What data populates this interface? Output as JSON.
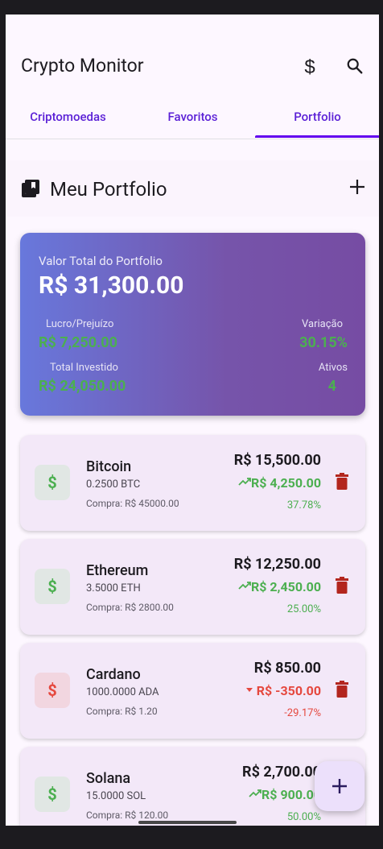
{
  "app": {
    "title": "Crypto Monitor"
  },
  "appbar": {
    "dollar_icon": "dollar-icon",
    "search_icon": "search-icon"
  },
  "tabs": [
    {
      "label": "Criptomoedas"
    },
    {
      "label": "Favoritos"
    },
    {
      "label": "Portfolio",
      "selected": true
    }
  ],
  "section": {
    "title": "Meu Portfolio",
    "icon": "wallet-icon",
    "action_icon": "add-icon"
  },
  "summary": {
    "label": "Valor Total do Portfolio",
    "total": "R$ 31,300.00",
    "profit_label": "Lucro/Prejuízo",
    "profit_value": "R$ 7,250.00",
    "variation_label": "Variação",
    "variation_value": "30.15%",
    "invested_label": "Total Investido",
    "invested_value": "R$ 24,050.00",
    "assets_label": "Ativos",
    "assets_value": "4"
  },
  "holdings": [
    {
      "name": "Bitcoin",
      "qty": "0.2500 BTC",
      "buy": "Compra: R$ 45000.00",
      "value": "R$ 15,500.00",
      "pl": "R$ 4,250.00",
      "pct": "37.78%",
      "trend": "up"
    },
    {
      "name": "Ethereum",
      "qty": "3.5000 ETH",
      "buy": "Compra: R$ 2800.00",
      "value": "R$ 12,250.00",
      "pl": "R$ 2,450.00",
      "pct": "25.00%",
      "trend": "up"
    },
    {
      "name": "Cardano",
      "qty": "1000.0000 ADA",
      "buy": "Compra: R$ 1.20",
      "value": "R$ 850.00",
      "pl": "R$ -350.00",
      "pct": "-29.17%",
      "trend": "down"
    },
    {
      "name": "Solana",
      "qty": "15.0000 SOL",
      "buy": "Compra: R$ 120.00",
      "value": "R$ 2,700.00",
      "pl": "R$ 900.00",
      "pct": "50.00%",
      "trend": "up"
    }
  ],
  "fab": {
    "icon": "add-icon"
  },
  "colors": {
    "accent": "#6200ee",
    "positive": "#4caf50",
    "negative": "#e5483e",
    "delete": "#b3261e"
  }
}
